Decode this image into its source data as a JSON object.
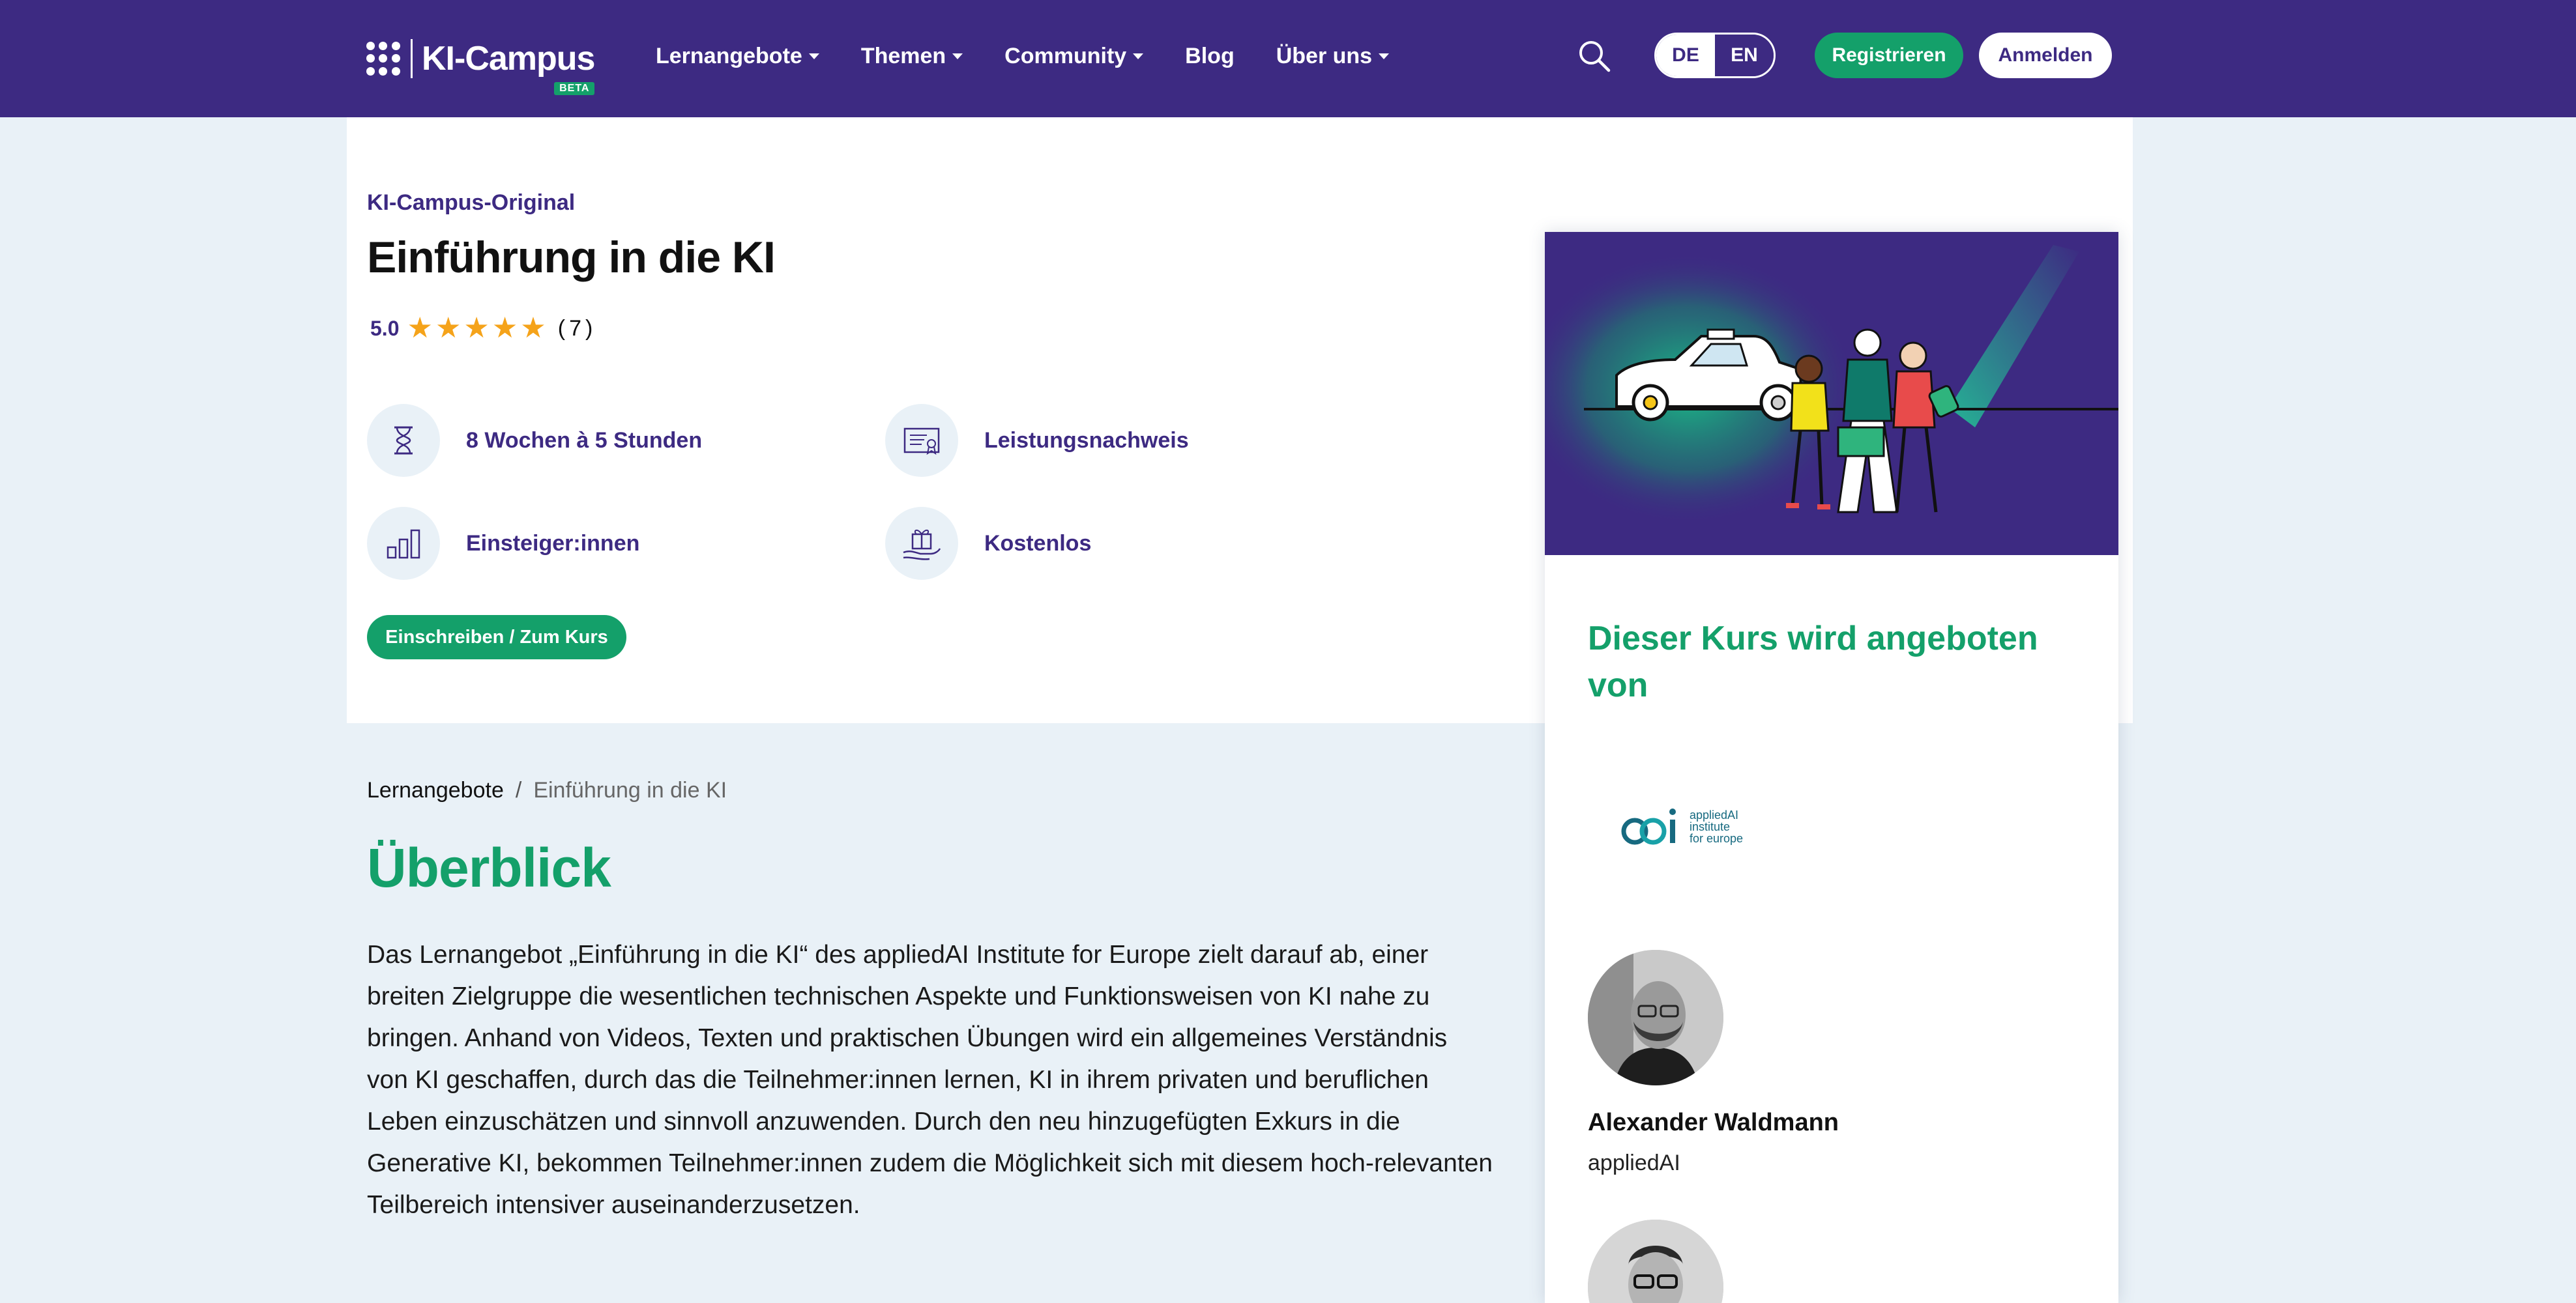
{
  "header": {
    "logo": {
      "name": "KI-Campus",
      "badge": "BETA"
    },
    "nav": [
      {
        "label": "Lernangebote",
        "dropdown": true
      },
      {
        "label": "Themen",
        "dropdown": true
      },
      {
        "label": "Community",
        "dropdown": true
      },
      {
        "label": "Blog",
        "dropdown": false
      },
      {
        "label": "Über uns",
        "dropdown": true
      }
    ],
    "search_icon": "search-icon",
    "language": {
      "options": [
        "DE",
        "EN"
      ],
      "selected": "DE"
    },
    "register_label": "Registrieren",
    "login_label": "Anmelden"
  },
  "course": {
    "label": "KI-Campus-Original",
    "title": "Einführung in die KI",
    "rating": {
      "value": "5.0",
      "stars": 5,
      "count": "(7)"
    },
    "features": [
      {
        "icon": "hourglass-icon",
        "label": "8 Wochen à 5 Stunden"
      },
      {
        "icon": "certificate-icon",
        "label": "Leistungsnachweis"
      },
      {
        "icon": "level-bars-icon",
        "label": "Einsteiger:innen"
      },
      {
        "icon": "gift-icon",
        "label": "Kostenlos"
      }
    ],
    "enroll_label": "Einschreiben / Zum Kurs"
  },
  "breadcrumb": {
    "link": "Lernangebote",
    "separator": "/",
    "current": "Einführung in die KI"
  },
  "overview": {
    "title": "Überblick",
    "text": "Das Lernangebot „Einführung in die KI“ des appliedAI Institute for Europe zielt darauf ab, einer breiten Zielgruppe die wesentlichen technischen Aspekte und Funktionsweisen von KI nahe zu bringen. Anhand von Videos, Texten und praktischen Übungen wird ein allgemeines Verständnis von KI geschaffen, durch das die Teilnehmer:innen lernen, KI in ihrem privaten und beruflichen Leben einzuschätzen und sinnvoll anzuwenden. Durch den neu hinzugefügten Exkurs in die Generative KI, bekommen Teilnehmer:innen zudem die Möglichkeit sich mit diesem hoch-relevanten Teilbereich intensiver auseinanderzusetzen."
  },
  "sidebar": {
    "heading": "Dieser Kurs wird angeboten von",
    "partner": {
      "name": "appliedAI",
      "lines": [
        "appliedAI",
        "institute",
        "for europe"
      ]
    },
    "persons": [
      {
        "name": "Alexander Waldmann",
        "org": "appliedAI"
      }
    ]
  },
  "colors": {
    "brand_purple": "#3d2a82",
    "brand_green": "#14a06a",
    "page_background": "#e9f1f7",
    "star": "#f5a31a"
  }
}
